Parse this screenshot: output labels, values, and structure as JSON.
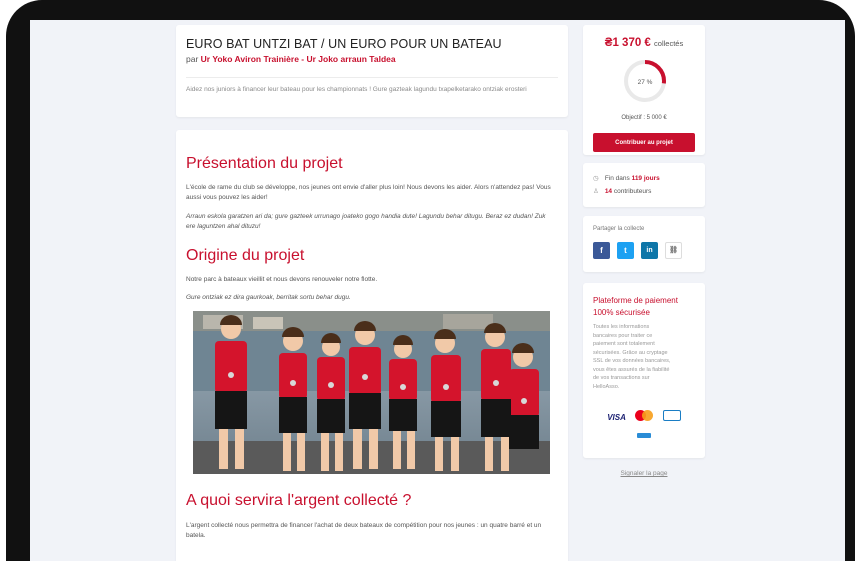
{
  "header": {
    "title": "EURO BAT UNTZI BAT / UN EURO POUR UN BATEAU",
    "by_prefix": "par",
    "author": "Ur Yoko Aviron Trainière - Ur Joko arraun Taldea",
    "description": "Aidez nos juniors à financer leur bateau pour les championnats ! Gure gazteak lagundu txapelketarako ontziak erosteri"
  },
  "content": {
    "sections": [
      {
        "heading": "Présentation du projet",
        "text_fr": "L'école de rame du club se développe, nos jeunes ont envie d'aller plus loin! Nous devons les aider. Alors n'attendez pas! Vous aussi vous pouvez les aider!",
        "text_eu": "Arraun eskola garatzen ari da; gure gazteek urrunago joateko gogo handia dute! Lagundu behar ditugu. Beraz ez dudan! Zuk ere laguntzen ahal dituzu!"
      },
      {
        "heading": "Origine du projet",
        "text_fr": "Notre parc à bateaux vieillit et nous devons renouveler notre flotte.",
        "text_eu": "Gure ontziak ez dira gaurkoak, berritak sortu behar dugu."
      },
      {
        "heading": "A quoi servira l'argent collecté ?",
        "text_fr": "L'argent collecté nous permettra de financer l'achat de deux bateaux de compétition pour nos jeunes : un quatre barré et un batela."
      }
    ]
  },
  "funding": {
    "amount": "1 370 €",
    "amount_suffix": "collectés",
    "percent_label": "27 %",
    "progress": 0.27,
    "goal": "Objectif : 5 000 €",
    "cta": "Contribuer au projet"
  },
  "stats": {
    "end_prefix": "Fin dans",
    "end_value": "119 jours",
    "contributors_value": "14",
    "contributors_label": "contributeurs"
  },
  "share": {
    "label": "Partager la collecte",
    "buttons": [
      {
        "icon": "facebook-icon",
        "glyph": "f",
        "color": "#3b5998"
      },
      {
        "icon": "twitter-icon",
        "glyph": "t",
        "color": "#1da1f2"
      },
      {
        "icon": "linkedin-icon",
        "glyph": "in",
        "color": "#0e76a8"
      },
      {
        "icon": "link-icon",
        "glyph": "🔗",
        "color": "#ffffff"
      }
    ]
  },
  "payment": {
    "title": "Plateforme de paiement 100% sécurisée",
    "description": "Toutes les informations bancaires pour traiter ce paiement sont totalement sécurisées. Grâce au cryptage SSL de vos données bancaires, vous êtes assurés de la fiabilité de vos transactions sur HelloAsso.",
    "visa": "VISA"
  },
  "report": "Signaler la page",
  "colors": {
    "accent": "#c8102e",
    "background": "#f1f3f8"
  }
}
